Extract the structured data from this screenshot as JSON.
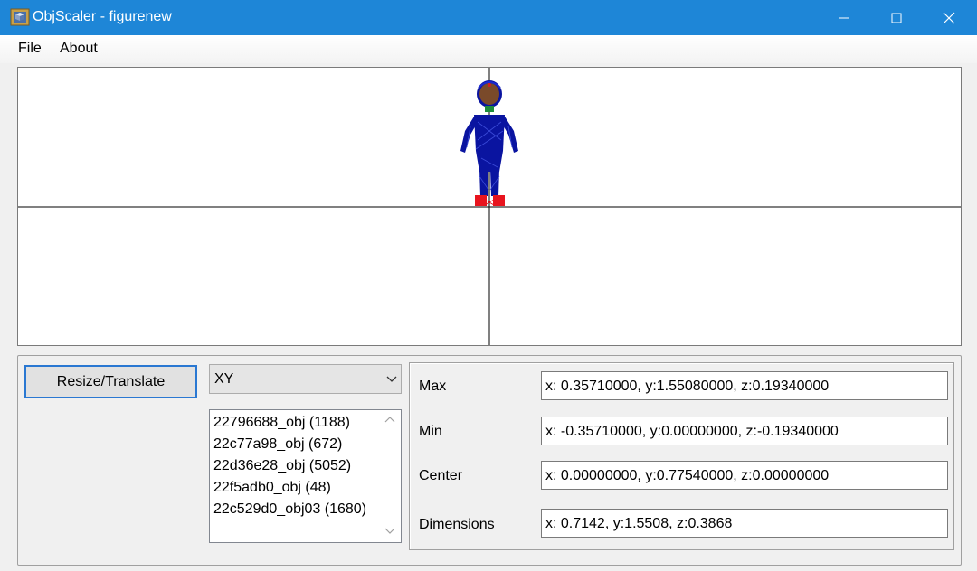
{
  "window": {
    "title": "ObjScaler - figurenew",
    "icon": "app-cube-icon"
  },
  "menu": {
    "file": "File",
    "about": "About"
  },
  "controls": {
    "resize_button": "Resize/Translate",
    "projection_select": "XY"
  },
  "objects": [
    "22796688_obj (1188)",
    "22c77a98_obj (672)",
    "22d36e28_obj (5052)",
    "22f5adb0_obj (48)",
    "22c529d0_obj03 (1680)"
  ],
  "bounds": {
    "max_label": "Max",
    "max_value": "x: 0.35710000, y:1.55080000, z:0.19340000",
    "min_label": "Min",
    "min_value": "x: -0.35710000, y:0.00000000, z:-0.19340000",
    "center_label": "Center",
    "center_value": "x: 0.00000000, y:0.77540000, z:0.00000000",
    "dimensions_label": "Dimensions",
    "dimensions_value": "x: 0.7142, y:1.5508, z:0.3868"
  },
  "colors": {
    "titlebar": "#1e86d7",
    "figure_mesh": "#0a14a0",
    "figure_head": "#7a4a2a",
    "figure_feet": "#e8141e",
    "figure_accent": "#1e8c3c",
    "selection_border": "#2a78d2"
  }
}
